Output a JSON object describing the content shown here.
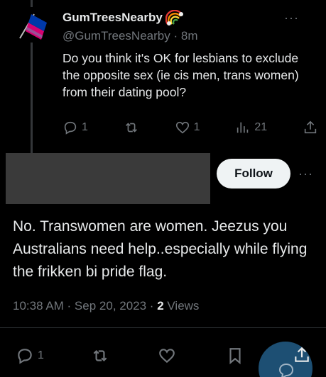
{
  "parent_tweet": {
    "display_name": "GumTreesNearby",
    "handle": "@GumTreesNearby",
    "time": "8m",
    "text": "Do you think it's OK for lesbians to exclude the opposite sex (ie cis men, trans women) from their dating pool?",
    "reply_count": "1",
    "like_count": "1",
    "view_count": "21",
    "icons": [
      "bisexual-flag-avatar",
      "rainbow-emoji",
      "more-icon",
      "reply-icon",
      "retweet-icon",
      "like-icon",
      "views-icon",
      "share-icon"
    ]
  },
  "main_tweet": {
    "follow_label": "Follow",
    "text": "No. Transwomen are women. Jeezus you Australians need help..especially while flying the frikken bi pride flag.",
    "timestamp": "10:38 AM · Sep 20, 2023 · ",
    "views_count": "2",
    "views_label": "Views",
    "reply_count": "1",
    "icons": [
      "more-icon",
      "reply-icon",
      "retweet-icon",
      "like-icon",
      "bookmark-icon",
      "share-icon",
      "compose-fab-icon"
    ]
  },
  "colors": {
    "background": "#000000",
    "text": "#e7e9ea",
    "muted": "#71767b",
    "follow_bg": "#eff3f4",
    "fab": "#1d4f73",
    "flag_pink": "#d60270",
    "flag_purple": "#9b4f96",
    "flag_blue": "#0038a8"
  }
}
